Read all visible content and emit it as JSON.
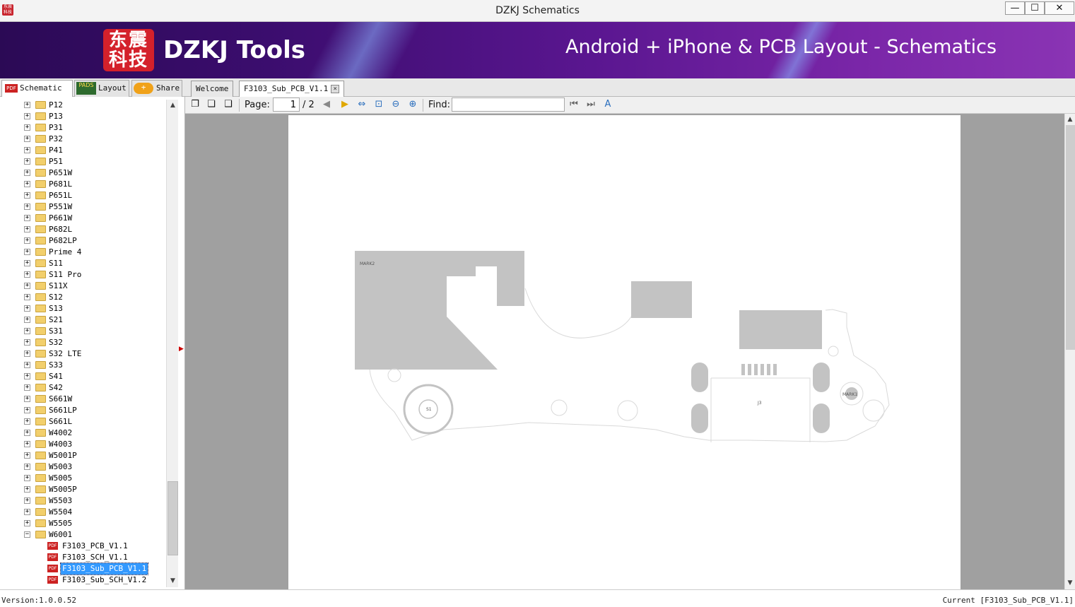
{
  "window": {
    "title": "DZKJ Schematics",
    "app_icon_text": "东震科技",
    "controls": {
      "minimize": "—",
      "maximize": "☐",
      "close": "✕"
    }
  },
  "banner": {
    "logo_text": "东震科技",
    "brand": "DZKJ Tools",
    "slogan": "Android + iPhone & PCB Layout - Schematics"
  },
  "left_tabs": [
    {
      "label": "Schematic",
      "icon": "PDF"
    },
    {
      "label": "Layout",
      "icon": "PADS"
    },
    {
      "label": "Share",
      "icon": "+"
    }
  ],
  "doc_tabs": [
    {
      "label": "Welcome"
    },
    {
      "label": "F3103_Sub_PCB_V1.1",
      "close": "×"
    }
  ],
  "tree": {
    "folders": [
      "P12",
      "P13",
      "P31",
      "P32",
      "P41",
      "P51",
      "P651W",
      "P681L",
      "P651L",
      "P551W",
      "P661W",
      "P682L",
      "P682LP",
      "Prime 4",
      "S11",
      "S11 Pro",
      "S11X",
      "S12",
      "S13",
      "S21",
      "S31",
      "S32",
      "S32 LTE",
      "S33",
      "S41",
      "S42",
      "S661W",
      "S661LP",
      "S661L",
      "W4002",
      "W4003",
      "W5001P",
      "W5003",
      "W5005",
      "W5005P",
      "W5503",
      "W5504",
      "W5505"
    ],
    "open_folder": "W6001",
    "files": [
      "F3103_PCB_V1.1",
      "F3103_SCH_V1.1",
      "F3103_Sub_PCB_V1.1",
      "F3103_Sub_SCH_V1.2"
    ],
    "selected_file": "F3103_Sub_PCB_V1.1",
    "expand_symbol": "+",
    "collapse_symbol": "−",
    "file_icon": "PDF"
  },
  "toolbar": {
    "page_label": "Page:",
    "page_value": "1",
    "page_total": "/ 2",
    "find_label": "Find:",
    "find_value": "",
    "icons": [
      "copy-icon",
      "copy-page-icon",
      "copy-all-icon",
      "prev-page-icon",
      "next-page-icon",
      "fit-width-icon",
      "fit-page-icon",
      "zoom-out-icon",
      "zoom-in-icon",
      "find-prev-icon",
      "find-next-icon",
      "highlight-icon"
    ]
  },
  "pcb": {
    "labels": {
      "mark2": "MARK2",
      "mark1": "MARK1",
      "j3": "J3",
      "s1": "S1"
    }
  },
  "status": {
    "version": "Version:1.0.0.52",
    "current": "Current [F3103_Sub_PCB_V1.1]"
  }
}
